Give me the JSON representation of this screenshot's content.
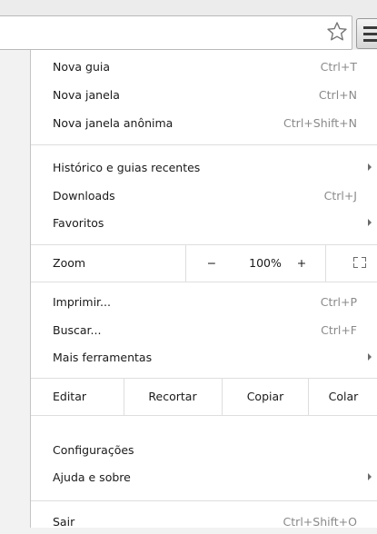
{
  "menu": {
    "new_items": [
      {
        "label": "Nova guia",
        "shortcut": "Ctrl+T"
      },
      {
        "label": "Nova janela",
        "shortcut": "Ctrl+N"
      },
      {
        "label": "Nova janela anônima",
        "shortcut": "Ctrl+Shift+N"
      }
    ],
    "history_items": [
      {
        "label": "Histórico e guias recentes",
        "shortcut": ""
      },
      {
        "label": "Downloads",
        "shortcut": "Ctrl+J"
      },
      {
        "label": "Favoritos",
        "shortcut": ""
      }
    ],
    "zoom": {
      "label": "Zoom",
      "minus": "−",
      "value": "100%",
      "plus": "+"
    },
    "tool_items": [
      {
        "label": "Imprimir...",
        "shortcut": "Ctrl+P"
      },
      {
        "label": "Buscar...",
        "shortcut": "Ctrl+F"
      },
      {
        "label": "Mais ferramentas",
        "shortcut": ""
      }
    ],
    "edit": {
      "label": "Editar",
      "cut": "Recortar",
      "copy": "Copiar",
      "paste": "Colar"
    },
    "settings_items": [
      {
        "label": "Configurações",
        "shortcut": ""
      },
      {
        "label": "Ajuda e sobre",
        "shortcut": ""
      }
    ],
    "exit": {
      "label": "Sair",
      "shortcut": "Ctrl+Shift+O"
    }
  },
  "icons": {
    "bookmark": "star-outline-icon",
    "menu": "hamburger-menu-icon",
    "fullscreen": "fullscreen-icon",
    "submenu": "submenu-arrow-icon"
  }
}
